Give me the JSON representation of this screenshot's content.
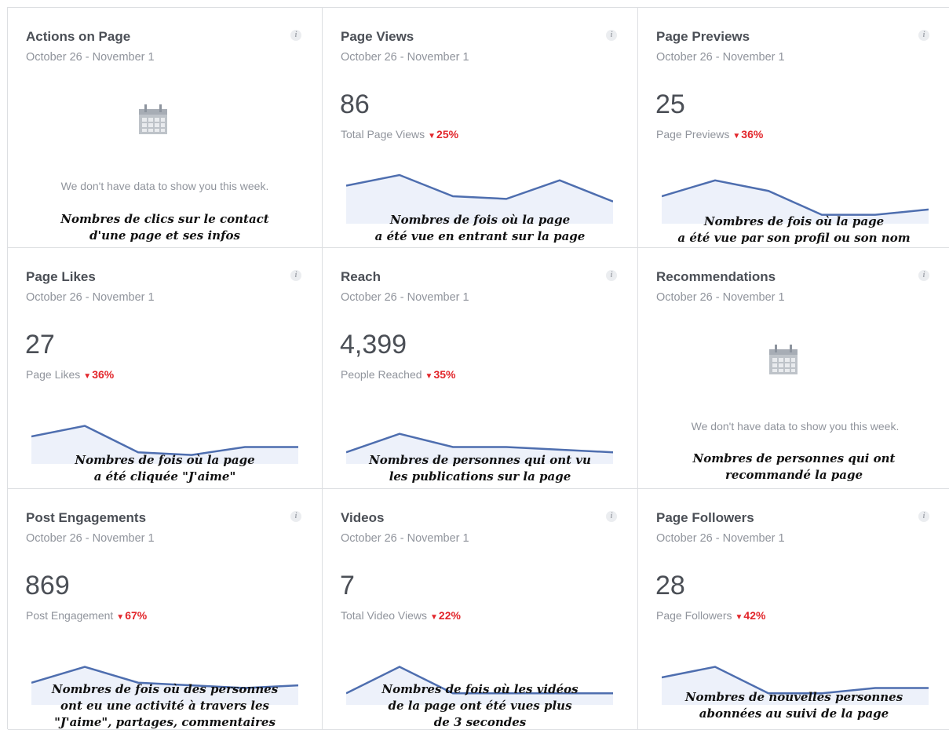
{
  "colors": {
    "line": "#4e6eaf",
    "fill": "#edf1fa",
    "decrease": "#e2262b",
    "title": "#4b4f56",
    "muted": "#90949c"
  },
  "info_icon_glyph": "i",
  "cards": [
    {
      "title": "Actions on Page",
      "date": "October 26 - November 1",
      "no_data": "We don't have data to show you this week.",
      "annotation": [
        "Nombres de clics sur le contact",
        "d'une page et ses infos"
      ]
    },
    {
      "title": "Page Views",
      "date": "October 26 - November 1",
      "value": "86",
      "label": "Total Page Views",
      "change": "25%",
      "change_symbol": "▼",
      "trend": [
        6,
        8,
        4,
        3.5,
        7,
        3
      ],
      "annotation": [
        "Nombres de fois où la page",
        "a été vue en entrant sur la page"
      ]
    },
    {
      "title": "Page Previews",
      "date": "October 26 - November 1",
      "value": "25",
      "label": "Page Previews",
      "change": "36%",
      "change_symbol": "▼",
      "trend": [
        4,
        7,
        5,
        0.5,
        0.5,
        1.5
      ],
      "annotation": [
        "Nombres de fois où la page",
        "a été vue par son profil ou son nom"
      ]
    },
    {
      "title": "Page Likes",
      "date": "October 26 - November 1",
      "value": "27",
      "label": "Page Likes",
      "change": "36%",
      "change_symbol": "▼",
      "trend": [
        4,
        6,
        1,
        0.5,
        2,
        2
      ],
      "annotation": [
        "Nombres de fois où la page",
        "a été cliquée \"J'aime\""
      ]
    },
    {
      "title": "Reach",
      "date": "October 26 - November 1",
      "value": "4,399",
      "label": "People Reached",
      "change": "35%",
      "change_symbol": "▼",
      "trend": [
        1,
        4.5,
        2,
        2,
        1.5,
        1
      ],
      "annotation": [
        "Nombres de personnes qui ont vu",
        "les publications sur la page"
      ]
    },
    {
      "title": "Recommendations",
      "date": "October 26 - November 1",
      "no_data": "We don't have data to show you this week.",
      "annotation": [
        "Nombres de personnes qui ont",
        "recommandé la page"
      ]
    },
    {
      "title": "Post Engagements",
      "date": "October 26 - November 1",
      "value": "869",
      "label": "Post Engagement",
      "change": "67%",
      "change_symbol": "▼",
      "trend": [
        3,
        6,
        3,
        2.5,
        2,
        2.5
      ],
      "annotation": [
        "Nombres de fois où des personnes",
        "ont eu une activité à travers les",
        "\"J'aime\", partages, commentaires"
      ]
    },
    {
      "title": "Videos",
      "date": "October 26 - November 1",
      "value": "7",
      "label": "Total Video Views",
      "change": "22%",
      "change_symbol": "▼",
      "trend": [
        1,
        6,
        1,
        1,
        1,
        1
      ],
      "annotation": [
        "Nombres de fois où les vidéos",
        "de la page ont été vues plus",
        "de 3 secondes"
      ]
    },
    {
      "title": "Page Followers",
      "date": "October 26 - November 1",
      "value": "28",
      "label": "Page Followers",
      "change": "42%",
      "change_symbol": "▼",
      "trend": [
        4,
        6,
        1,
        1,
        2,
        2
      ],
      "annotation": [
        "Nombres de nouvelles personnes",
        "abonnées au suivi de la page"
      ]
    }
  ]
}
